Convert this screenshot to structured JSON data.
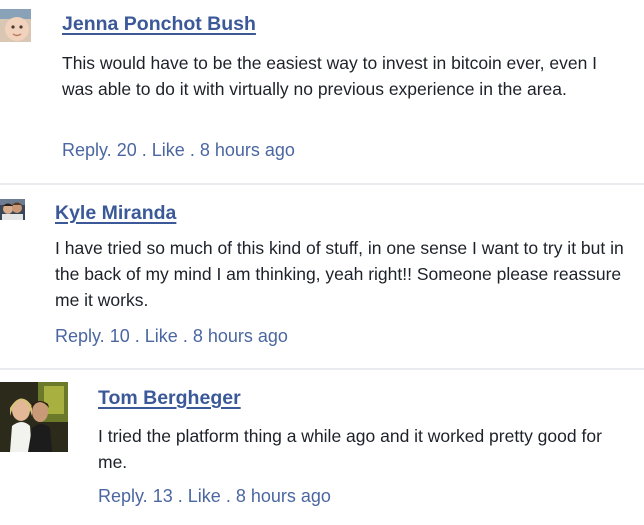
{
  "comments": [
    {
      "author": "Jenna Ponchot Bush",
      "avatar_icon": "baby-photo-avatar",
      "text": "This would have to be the easiest way to invest in bitcoin ever, even I was able to do it with virtually no previous experience in the area.",
      "reply_label": "Reply.",
      "reply_count": "20",
      "like_label": "Like",
      "time": "8 hours ago",
      "separator": "."
    },
    {
      "author": "Kyle Miranda",
      "avatar_icon": "couple-photo-avatar",
      "text": "I have tried so much of this kind of stuff, in one sense I want to try it but in the back of my mind I am thinking, yeah right!! Someone please reassure me it works.",
      "reply_label": "Reply.",
      "reply_count": "10",
      "like_label": "Like",
      "time": "8 hours ago",
      "separator": "."
    },
    {
      "author": "Tom Bergheger",
      "avatar_icon": "couple-photo-avatar",
      "text": "I tried the platform thing a while ago and it worked pretty good for me.",
      "reply_label": "Reply.",
      "reply_count": "13",
      "like_label": "Like",
      "time": "8 hours ago",
      "separator": "."
    }
  ],
  "colors": {
    "link": "#3b5998",
    "meta": "#4b67a1",
    "text": "#1d2129",
    "divider": "#e9ebee"
  }
}
